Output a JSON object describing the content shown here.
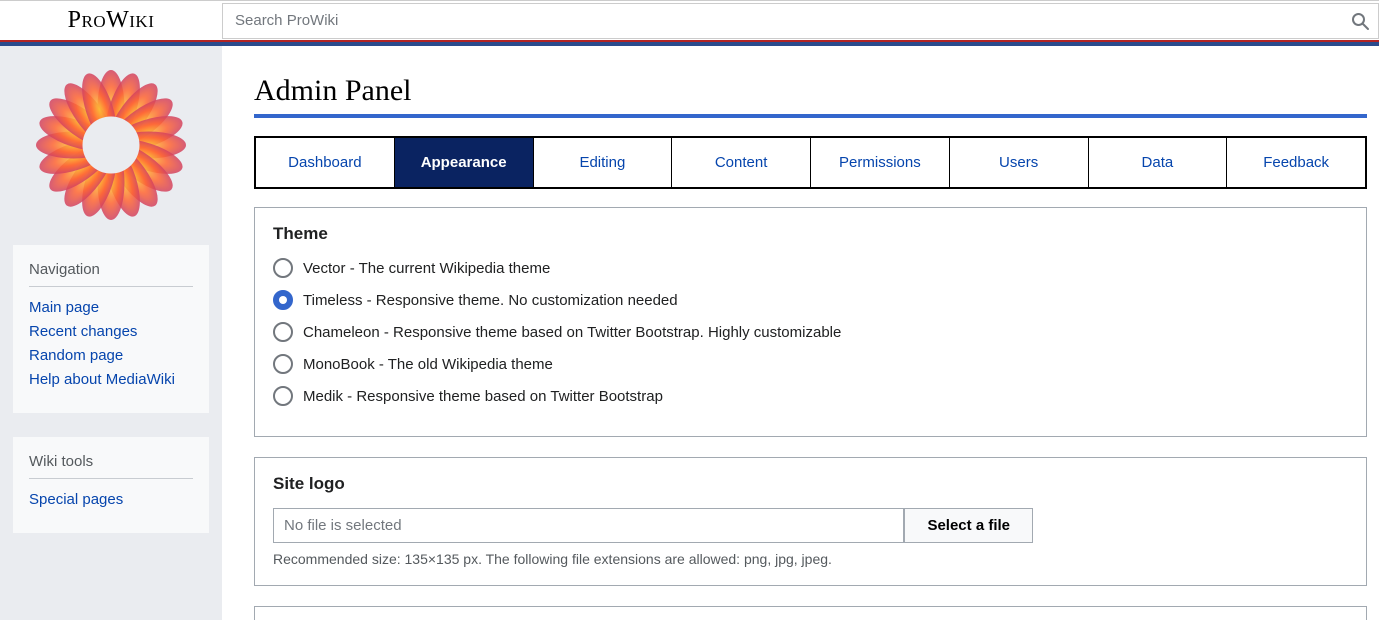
{
  "brand": "ProWiki",
  "search": {
    "placeholder": "Search ProWiki"
  },
  "sidebar": {
    "nav_title": "Navigation",
    "nav_items": [
      "Main page",
      "Recent changes",
      "Random page",
      "Help about MediaWiki"
    ],
    "tools_title": "Wiki tools",
    "tools_items": [
      "Special pages"
    ]
  },
  "page_title": "Admin Panel",
  "tabs": [
    "Dashboard",
    "Appearance",
    "Editing",
    "Content",
    "Permissions",
    "Users",
    "Data",
    "Feedback"
  ],
  "active_tab": 1,
  "theme": {
    "title": "Theme",
    "options": [
      "Vector - The current Wikipedia theme",
      "Timeless - Responsive theme. No customization needed",
      "Chameleon - Responsive theme based on Twitter Bootstrap. Highly customizable",
      "MonoBook - The old Wikipedia theme",
      "Medik - Responsive theme based on Twitter Bootstrap"
    ],
    "selected": 1
  },
  "site_logo": {
    "title": "Site logo",
    "file_text": "No file is selected",
    "button": "Select a file",
    "hint": "Recommended size: 135×135 px. The following file extensions are allowed: png, jpg, jpeg."
  }
}
